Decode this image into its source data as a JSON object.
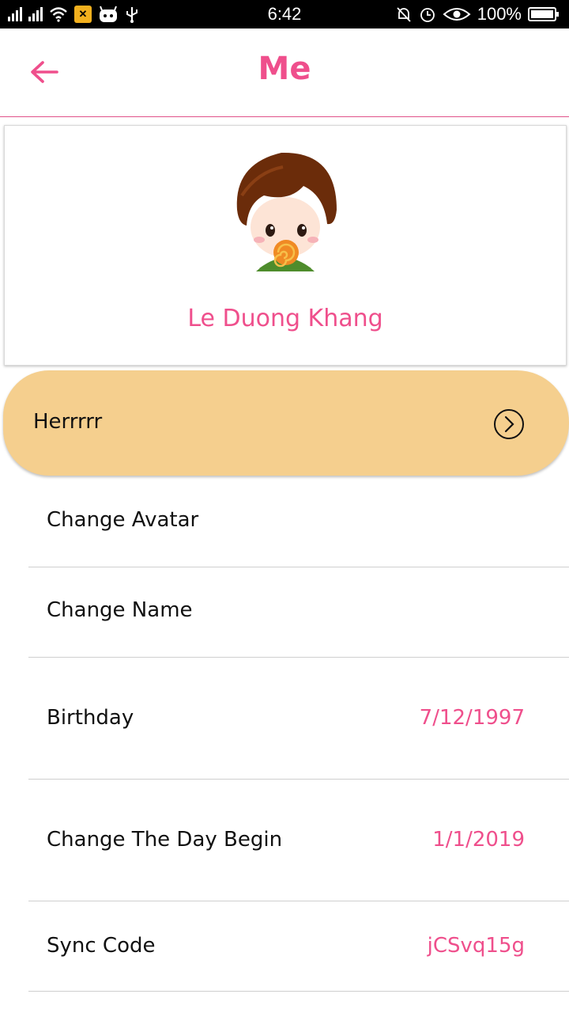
{
  "status_bar": {
    "time": "6:42",
    "battery": "100%",
    "icons": [
      "signal-icon",
      "signal-icon",
      "wifi-icon",
      "app-icon",
      "android-icon",
      "usb-icon",
      "mute-icon",
      "alarm-icon",
      "eye-icon",
      "battery-icon"
    ]
  },
  "header": {
    "title": "Me",
    "back_icon": "arrow-left-icon"
  },
  "profile": {
    "name": "Le Duong Khang",
    "avatar": "cartoon-boy-lollipop-avatar"
  },
  "highlight": {
    "label": "Herrrrr",
    "icon": "chevron-right-circle-icon"
  },
  "settings": [
    {
      "label": "Change Avatar",
      "value": ""
    },
    {
      "label": "Change Name",
      "value": ""
    },
    {
      "label": "Birthday",
      "value": "7/12/1997"
    },
    {
      "label": "Change The Day Begin",
      "value": "1/1/2019"
    },
    {
      "label": "Sync Code",
      "value": "jCSvq15g"
    }
  ],
  "colors": {
    "accent": "#ef4f8c",
    "highlight_bg": "#f5cf8e",
    "status_bar_bg": "#000000"
  }
}
